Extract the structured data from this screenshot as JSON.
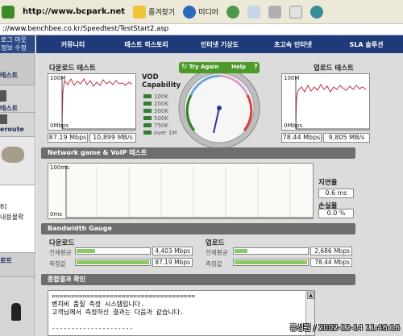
{
  "browser": {
    "toolbar": {
      "back_label": "⇦",
      "url_text": "http://www.bcpark.net",
      "favorites_label": "즐겨찾기",
      "media_label": "미디어"
    },
    "address": "://www.benchbee.co.kr/Speedtest/TestStart2.asp"
  },
  "sidebar": {
    "top_lines": [
      "로그 아웃",
      "정보 수정"
    ],
    "items": [
      "테스트",
      "테스트",
      "eroute",
      "8]",
      "내용물확",
      "로트"
    ]
  },
  "nav": {
    "items": [
      "커뮤니티",
      "테스트 히스토리",
      "인터넷 기상도",
      "초고속 인터넷",
      "SLA 솔루션"
    ]
  },
  "download": {
    "title": "다운로드 테스트",
    "max_label": "100M",
    "min_label": "0Mbps",
    "mbps": "87.19 Mbps",
    "mbs": "10,899 MB/s"
  },
  "upload": {
    "title": "업로드 테스트",
    "max_label": "100M",
    "min_label": "0Mbps",
    "mbps": "78.44 Mbps",
    "mbs": "9,805 MB/s"
  },
  "vod": {
    "title": "VOD Capability",
    "levels": [
      "100K",
      "200K",
      "300K",
      "500K",
      "750K",
      "over 1M"
    ]
  },
  "gauge": {
    "try_again_label": "Try Again",
    "help_label": "Help"
  },
  "game": {
    "title": "Network game & VoIP 테스트",
    "max_label": "100ms",
    "min_label": "0ms",
    "latency_label": "지연율",
    "latency_value": "0.6 ms",
    "loss_label": "손실율",
    "loss_value": "0.0 %"
  },
  "bandwidth": {
    "title": "Bandwidth Gauge",
    "download": {
      "title": "다운로드",
      "avg_label": "전체평균",
      "avg_value": "4,403 Mbps",
      "avg_fraction": 0.27,
      "measured_label": "측정값",
      "measured_value": "87.19 Mbps",
      "measured_fraction": 1.0
    },
    "upload": {
      "title": "업로드",
      "avg_label": "전체평균",
      "avg_value": "2,686 Mbps",
      "avg_fraction": 0.2,
      "measured_label": "측정값",
      "measured_value": "78.44 Mbps",
      "measured_fraction": 1.0
    }
  },
  "result": {
    "title": "종합결과 확인",
    "lines": [
      "=====================================",
      "벤치비 품질 측정 시스템입니다.",
      "고객님께서 측정하신 결과는 다음과 같습니다.",
      "",
      "---------------------"
    ]
  },
  "watermark": "홍성원 / 2002-12-14 11:46:16",
  "colors": {
    "nav": "#1f3a78",
    "gauge_green": "#4c9a2a",
    "fill": "#8cc864",
    "graph_line": "#c0303c"
  }
}
